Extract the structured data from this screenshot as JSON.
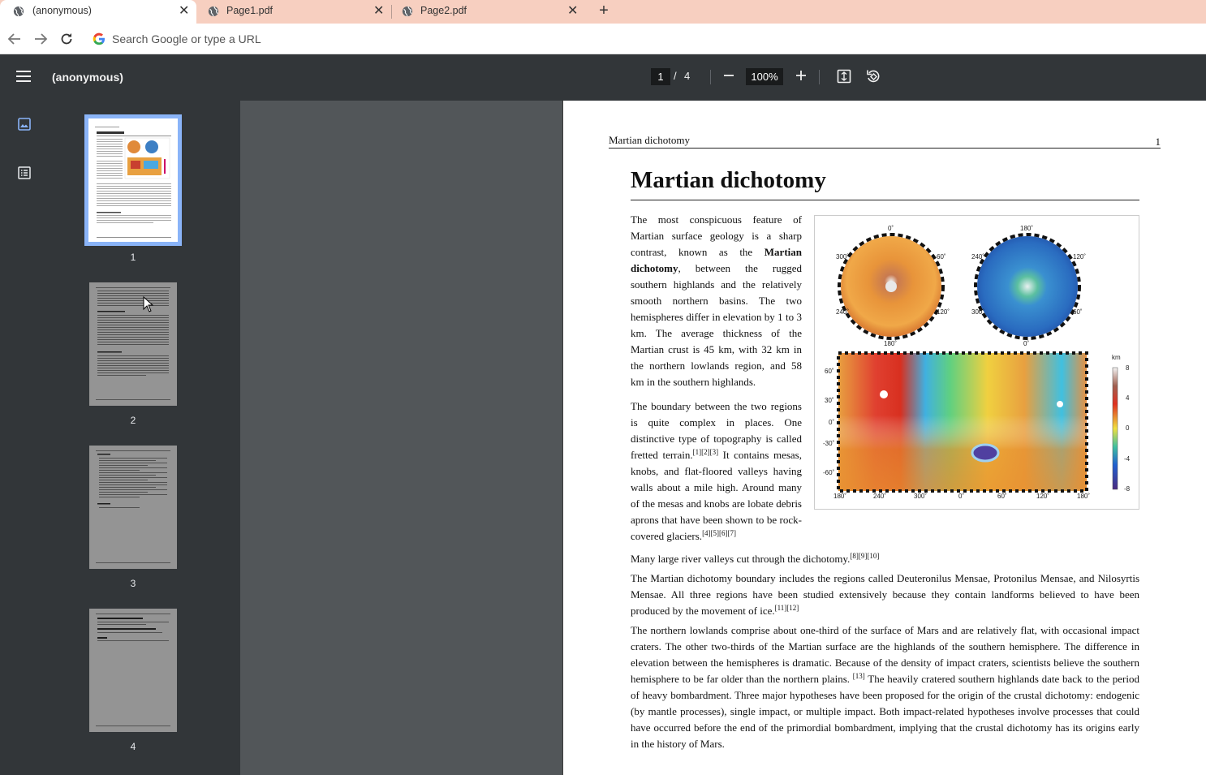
{
  "browser": {
    "tabs": [
      {
        "title": "(anonymous)",
        "active": true
      },
      {
        "title": "Page1.pdf",
        "active": false
      },
      {
        "title": "Page2.pdf",
        "active": false
      }
    ],
    "new_tab": "+",
    "close_glyph": "✕",
    "omnibox_placeholder": "Search Google or type a URL",
    "colors": {
      "tabbar": "#f7cfc0",
      "toolbar": "#323639",
      "viewer_bg": "#525659",
      "thumb_selected": "#8ab4f8"
    }
  },
  "pdf_toolbar": {
    "title": "(anonymous)",
    "current_page": "1",
    "page_separator": "/",
    "total_pages": "4",
    "zoom": "100%"
  },
  "sidebar": {
    "icons": [
      "thumbnails-icon",
      "outline-icon"
    ],
    "thumbnails": [
      {
        "number": "1",
        "selected": true
      },
      {
        "number": "2",
        "selected": false
      },
      {
        "number": "3",
        "selected": false
      },
      {
        "number": "4",
        "selected": false
      }
    ]
  },
  "document": {
    "running_head": "Martian dichotomy",
    "page_number": "1",
    "title": "Martian dichotomy",
    "p1_a": "The most conspicuous feature of Martian surface geology is a sharp contrast, known as the ",
    "p1_bold": "Martian dichotomy",
    "p1_b": ", between the rugged southern highlands and the relatively smooth northern basins. The two hemispheres differ in elevation by 1 to 3 km. The average thickness of the Martian crust is 45 km, with 32 km in the northern lowlands region, and 58 km in the southern highlands.",
    "p2_a": "The boundary between the two regions is quite complex in places. One distinctive type of topography is called fretted terrain.",
    "p2_ref1": "[1][2][3]",
    "p2_b": " It contains mesas, knobs, and flat-floored valleys having walls about a mile high. Around many of the mesas and knobs are lobate debris aprons that have been shown to be rock-covered glaciers.",
    "p2_ref2": "[4][5][6][7]",
    "p3": "Many large river valleys cut through the dichotomy.",
    "p3_ref": "[8][9][10]",
    "p4": "The Martian dichotomy boundary includes the regions called Deuteronilus Mensae, Protonilus Mensae, and Nilosyrtis Mensae. All three regions have been studied extensively because they contain landforms believed to have been produced by the movement of ice.",
    "p4_ref": "[11][12]",
    "p5_a": "The northern lowlands comprise about one-third of the surface of Mars and are relatively flat, with occasional impact craters. The other two-thirds of the Martian surface are the highlands of the southern hemisphere. The difference in elevation between the hemispheres is dramatic. Because of the density of impact craters, scientists believe the southern hemisphere to be far older than the northern plains. ",
    "p5_ref": "[13]",
    "p5_b": " The heavily cratered southern highlands date back to the period of heavy bombardment. Three major hypotheses have been proposed for the origin of the crustal dichotomy: endogenic (by mantle processes), single impact, or multiple impact. Both impact-related hypotheses involve processes that could have occurred before the end of the primordial bombardment, implying that the crustal dichotomy has its origins early in the history of Mars.",
    "figure": {
      "globe1_labels": [
        "0˚",
        "300˚",
        "60˚",
        "240˚",
        "120˚",
        "180˚"
      ],
      "globe2_labels": [
        "180˚",
        "240˚",
        "120˚",
        "300˚",
        "60˚",
        "0˚"
      ],
      "lat_labels": [
        "60˚",
        "30˚",
        "0˚",
        "-30˚",
        "-60˚"
      ],
      "lon_labels": [
        "180˚",
        "240˚",
        "300˚",
        "0˚",
        "60˚",
        "120˚",
        "180˚"
      ],
      "scale_unit": "km",
      "scale_labels": [
        "8",
        "4",
        "0",
        "-4",
        "-8"
      ]
    }
  }
}
